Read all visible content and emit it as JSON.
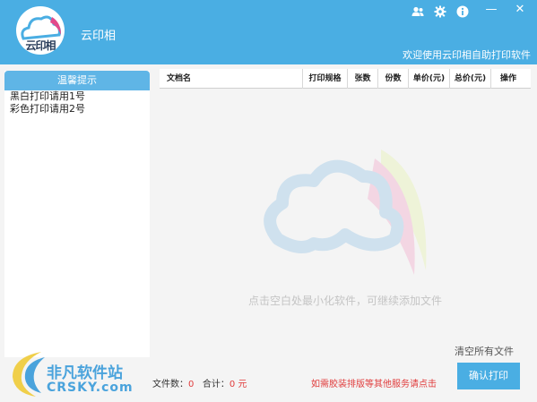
{
  "header": {
    "logo_text": "云印相",
    "app_title": "云印相",
    "welcome": "欢迎使用云印相自助打印软件",
    "icons": [
      "user-group-icon",
      "gear-icon",
      "info-icon"
    ],
    "minimize": "—",
    "close": "✕",
    "bg_color": "#4aaee3"
  },
  "tips": {
    "title": "温馨提示",
    "lines": [
      "黑白打印请用1号",
      "彩色打印请用2号"
    ]
  },
  "table": {
    "columns": [
      "文档名",
      "打印规格",
      "张数",
      "份数",
      "单价(元)",
      "总价(元)",
      "操作"
    ],
    "rows": []
  },
  "main": {
    "hint": "点击空白处最小化软件，可继续添加文件"
  },
  "footer": {
    "clear_all": "清空所有文件",
    "file_count_label": "文件数：",
    "file_count": "0",
    "total_label": "合计：",
    "total": "0",
    "currency": "元",
    "service_notice": "如需胶装排版等其他服务请点击",
    "confirm_print": "确认打印"
  },
  "corner_watermark": {
    "text_cn": "非凡软件站",
    "text_en": "CRSKY.com"
  }
}
